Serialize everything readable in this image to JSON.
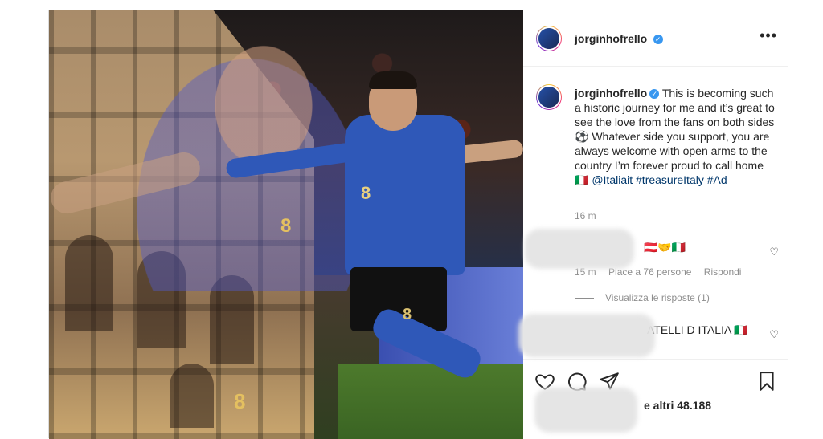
{
  "post": {
    "username": "jorginhofrello",
    "verified_icon": "verified-badge-icon",
    "caption": {
      "text": "This is becoming such a historic journey for me and it’s great to see the love from the fans on both sides ⚽ Whatever side you support, you are always welcome with open arms to the country I’m forever proud to call home 🇮🇹",
      "mention": "@Italiait",
      "hashtag1": "#treasureItaly",
      "hashtag2": "#Ad"
    },
    "time": "16 m",
    "jersey_numbers": [
      "8",
      "8",
      "8",
      "8"
    ]
  },
  "comments": [
    {
      "text": "🇦🇹🤝🇮🇹",
      "time": "15 m",
      "likes": "Piace a 76 persone",
      "reply": "Rispondi",
      "view_replies": "Visualizza le risposte (1)"
    },
    {
      "text": "ATELLI D ITALIA 🇮🇹"
    }
  ],
  "footer": {
    "likes_text": "e altri 48.188"
  },
  "colors": {
    "link": "#00376b",
    "verified": "#3897f0",
    "muted": "#8e8e8e"
  }
}
